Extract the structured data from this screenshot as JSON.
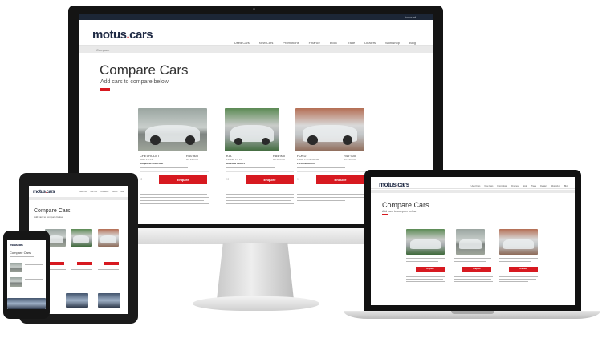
{
  "brand": {
    "logo_main": "motus",
    "logo_dot": ".",
    "logo_tail": "cars",
    "accent_color": "#d71920",
    "navy_color": "#1f2a44"
  },
  "imac": {
    "top_account": "Account",
    "nav": [
      "Used Cars",
      "New Cars",
      "Promotions",
      "Finance",
      "Book",
      "Trade",
      "Dealers",
      "Workshop",
      "Blog"
    ],
    "breadcrumb": "Compare",
    "title": "Compare Cars",
    "subtitle": "Add cars to compare below",
    "cars": [
      {
        "make": "CHEVROLET",
        "price": "R60 800",
        "sub_price": "R1 395 PM",
        "model": "Aveo 1.6 LS",
        "dealer": "Ridgefield Chevrolet",
        "photo": "silver"
      },
      {
        "make": "KIA",
        "price": "R84 900",
        "sub_price": "R1 624 PM",
        "model": "Picanto 1.2 LS",
        "dealer": "Ricevale Motors",
        "photo": "green"
      },
      {
        "make": "FORD",
        "price": "R49 900",
        "sub_price": "R1 013 PM",
        "model": "Fiesta 1.4i Ambiente",
        "dealer": "Ford Centurion",
        "photo": "rust"
      }
    ],
    "enquire_label": "Enquire"
  },
  "laptop": {
    "title": "Compare Cars",
    "subtitle": "Add cars to compare below",
    "enquire_label": "Enquire"
  },
  "tablet": {
    "title": "Compare Cars",
    "subtitle": "Add cars to compare below"
  },
  "phone": {
    "title": "Compare Cars"
  }
}
